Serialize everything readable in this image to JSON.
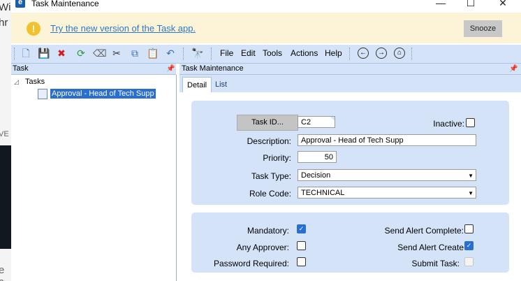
{
  "window": {
    "title": "Task Maintenance",
    "controls": {
      "minimize": "—",
      "maximize": "☐",
      "close": "✕"
    }
  },
  "background": {
    "fragments": [
      "Wi",
      "hr",
      "VE",
      "e c"
    ]
  },
  "notification": {
    "link_text": "Try the new version of the Task app.",
    "snooze_label": "Snooze",
    "icon": "info-icon"
  },
  "toolbar": {
    "icons": [
      "new-icon",
      "save-icon",
      "delete-icon",
      "refresh-icon",
      "eraser-icon",
      "cut-icon",
      "copy-icon",
      "paste-icon",
      "undo-icon",
      "find-icon"
    ],
    "menus": [
      "File",
      "Edit",
      "Tools",
      "Actions",
      "Help"
    ],
    "nav": {
      "back": "back-icon",
      "forward": "forward-icon",
      "home": "home-icon"
    }
  },
  "tree_pane": {
    "header": "Task",
    "root": "Tasks",
    "items": [
      "Approval - Head of Tech Supp"
    ]
  },
  "detail_pane": {
    "header": "Task Maintenance",
    "tabs": [
      "Detail",
      "List"
    ],
    "active_tab": "Detail"
  },
  "form": {
    "task_id_button": "Task ID...",
    "task_id_value": "C2",
    "inactive_label": "Inactive:",
    "inactive_checked": false,
    "description_label": "Description:",
    "description_value": "Approval - Head of Tech Supp",
    "priority_label": "Priority:",
    "priority_value": "50",
    "task_type_label": "Task Type:",
    "task_type_value": "Decision",
    "role_code_label": "Role Code:",
    "role_code_value": "TECHNICAL",
    "mandatory_label": "Mandatory:",
    "mandatory_checked": true,
    "any_approver_label": "Any Approver:",
    "any_approver_checked": false,
    "password_required_label": "Password Required:",
    "password_required_checked": false,
    "send_alert_complete_label": "Send Alert Complete:",
    "send_alert_complete_checked": false,
    "send_alert_create_label": "Send Alert Create",
    "send_alert_create_checked": true,
    "submit_task_label": "Submit Task:",
    "submit_task_checked": false
  },
  "colors": {
    "accent": "#2a6fd0",
    "toolbar_bg": "#d4e3f7",
    "notify_bg": "#fdf3d7",
    "link": "#2a79c9"
  }
}
